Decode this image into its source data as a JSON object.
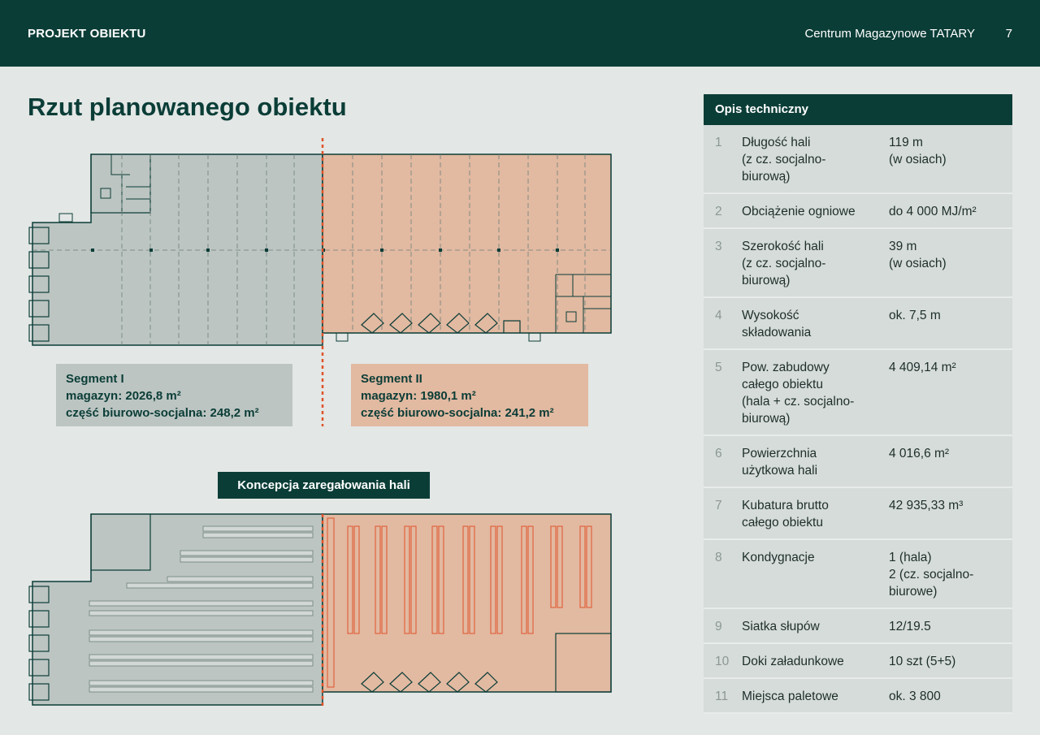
{
  "header": {
    "section": "PROJEKT OBIEKTU",
    "document": "Centrum Magazynowe TATARY",
    "page": "7"
  },
  "title": "Rzut planowanego obiektu",
  "segments": [
    {
      "name": "Segment I",
      "warehouse": "magazyn: 2026,8 m²",
      "office": "część biurowo-socjalna: 248,2 m²"
    },
    {
      "name": "Segment II",
      "warehouse": "magazyn: 1980,1 m²",
      "office": "część biurowo-socjalna: 241,2 m²"
    }
  ],
  "concept_label": "Koncepcja zaregałowania hali",
  "colors": {
    "dark": "#0b3d37",
    "segment1": "#bcc5c2",
    "segment2": "#e2b9a1",
    "divider": "#e0522a"
  },
  "spec": {
    "title": "Opis techniczny",
    "rows": [
      {
        "n": "1",
        "k": "Długość hali\n(z cz. socjalno-\nbiurową)",
        "v": "119 m\n(w osiach)"
      },
      {
        "n": "2",
        "k": "Obciążenie ogniowe",
        "v": "do 4 000 MJ/m²"
      },
      {
        "n": "3",
        "k": "Szerokość hali\n(z cz. socjalno-\nbiurową)",
        "v": "39 m\n(w osiach)"
      },
      {
        "n": "4",
        "k": "Wysokość\nskładowania",
        "v": "ok. 7,5 m"
      },
      {
        "n": "5",
        "k": "Pow. zabudowy\ncałego obiektu\n(hala + cz. socjalno-\nbiurową)",
        "v": "4 409,14 m²"
      },
      {
        "n": "6",
        "k": "Powierzchnia\nużytkowa hali",
        "v": "4 016,6 m²"
      },
      {
        "n": "7",
        "k": "Kubatura brutto\ncałego obiektu",
        "v": "42 935,33 m³"
      },
      {
        "n": "8",
        "k": "Kondygnacje",
        "v": "1 (hala)\n2 (cz. socjalno-\nbiurowe)"
      },
      {
        "n": "9",
        "k": "Siatka słupów",
        "v": "12/19.5"
      },
      {
        "n": "10",
        "k": "Doki załadunkowe",
        "v": "10 szt (5+5)"
      },
      {
        "n": "11",
        "k": "Miejsca paletowe",
        "v": "ok. 3 800"
      }
    ]
  }
}
